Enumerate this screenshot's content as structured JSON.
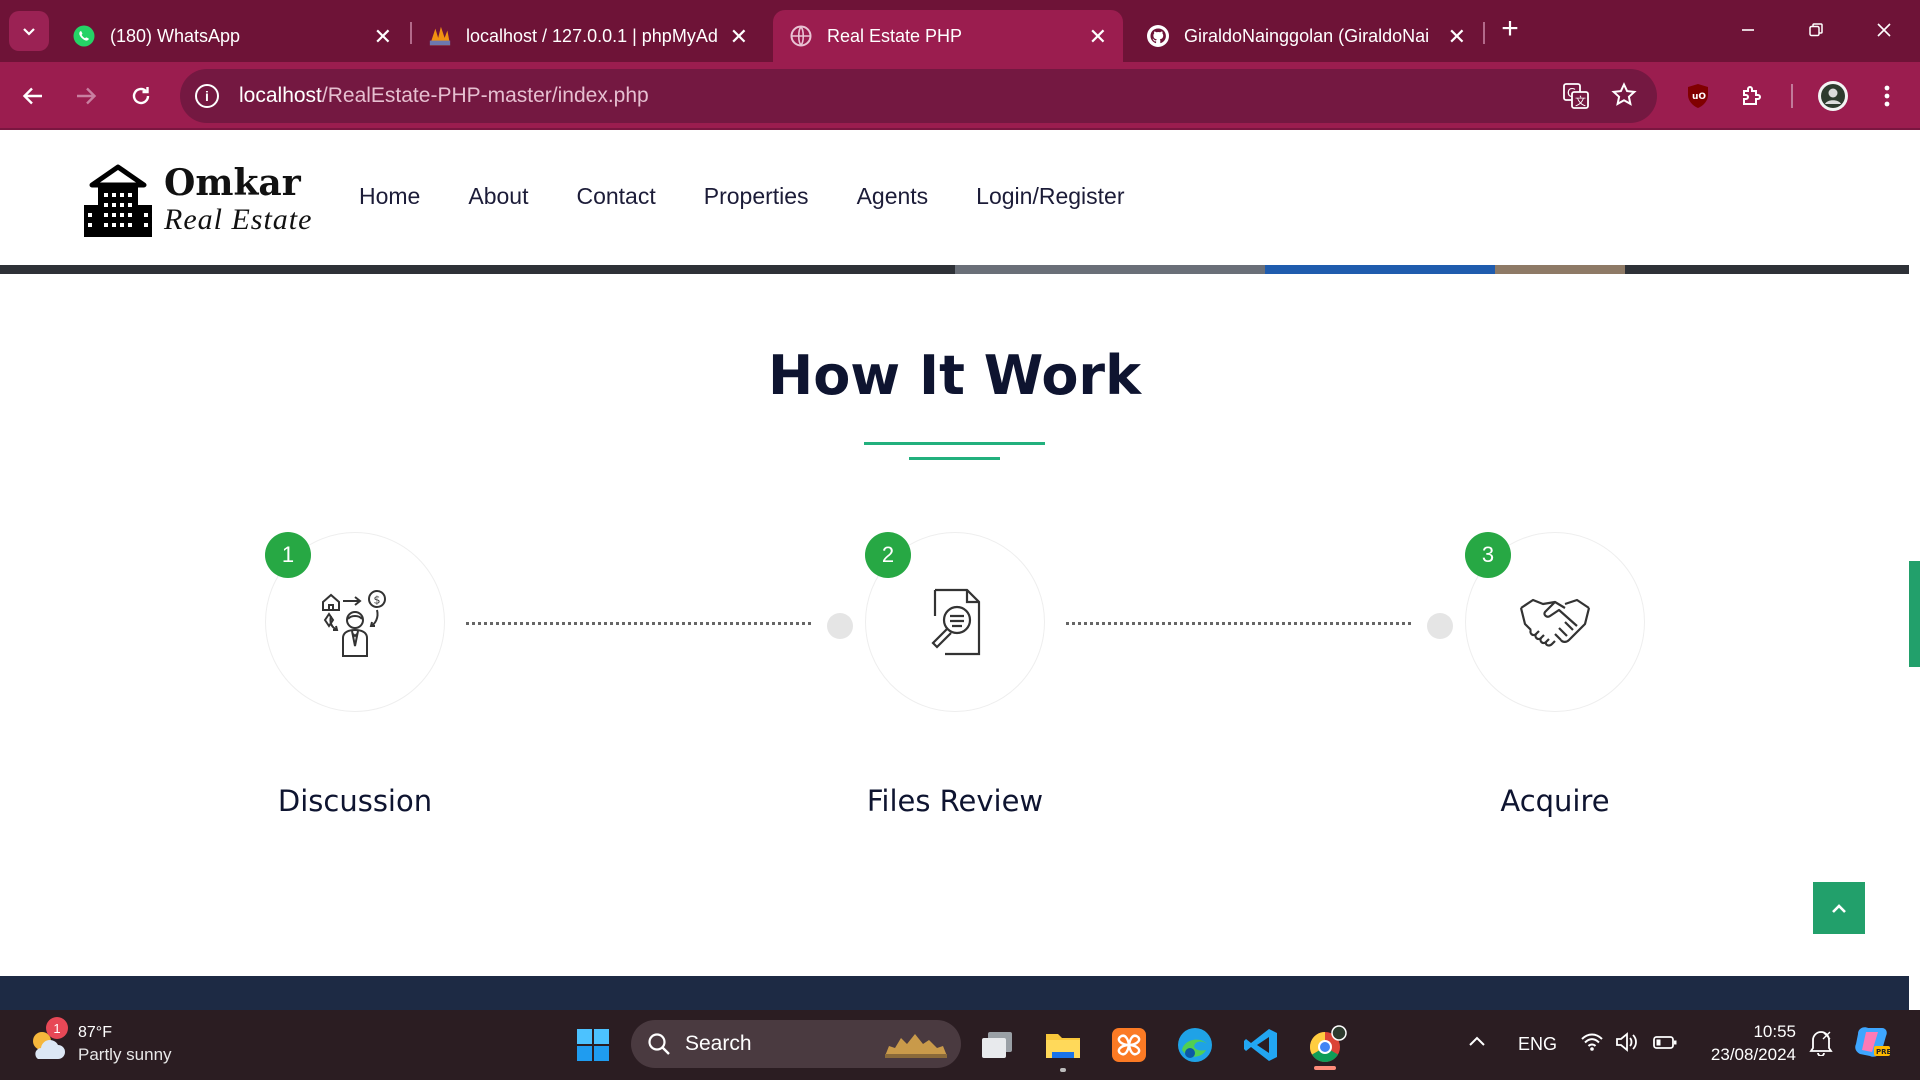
{
  "browser": {
    "tabs": [
      {
        "title": "(180) WhatsApp",
        "icon": "whatsapp-icon",
        "active": false
      },
      {
        "title": "localhost / 127.0.0.1 | phpMyAd",
        "icon": "phpmyadmin-icon",
        "active": false
      },
      {
        "title": "Real Estate PHP",
        "icon": "globe-icon",
        "active": true
      },
      {
        "title": "GiraldoNainggolan (GiraldoNai",
        "icon": "github-icon",
        "active": false
      }
    ],
    "url_host": "localhost",
    "url_path": "/RealEstate-PHP-master/index.php",
    "accent": "#9b1d4f"
  },
  "site": {
    "brand": "Omkar",
    "brand_sub": "Real Estate",
    "nav": [
      "Home",
      "About",
      "Contact",
      "Properties",
      "Agents",
      "Login/Register"
    ]
  },
  "how_it_works": {
    "title": "How It Work",
    "accent": "#22b07d",
    "steps": [
      {
        "number": "1",
        "label": "Discussion",
        "icon": "discussion-icon"
      },
      {
        "number": "2",
        "label": "Files Review",
        "icon": "files-review-icon"
      },
      {
        "number": "3",
        "label": "Acquire",
        "icon": "handshake-icon"
      }
    ],
    "badge_color": "#27a844"
  },
  "taskbar": {
    "weather_temp": "87°F",
    "weather_desc": "Partly sunny",
    "weather_badge": "1",
    "search_label": "Search",
    "language": "ENG",
    "time": "10:55",
    "date": "23/08/2024"
  }
}
